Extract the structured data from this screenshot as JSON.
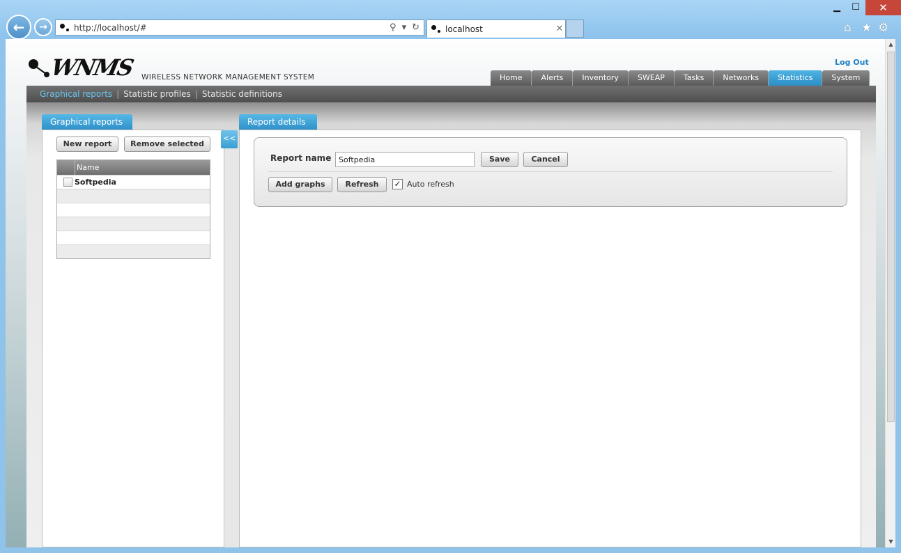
{
  "browser": {
    "url": "http://localhost/#",
    "tab_title": "localhost",
    "tab_close": "✕",
    "min_glyph": "▁",
    "max_glyph": "☐",
    "close_glyph": "✕"
  },
  "app": {
    "logo_text": "WNMS",
    "subtitle": "WIRELESS NETWORK MANAGEMENT SYSTEM",
    "logout": "Log Out"
  },
  "main_nav": {
    "items": [
      {
        "label": "Home"
      },
      {
        "label": "Alerts"
      },
      {
        "label": "Inventory"
      },
      {
        "label": "SWEAP"
      },
      {
        "label": "Tasks"
      },
      {
        "label": "Networks"
      },
      {
        "label": "Statistics",
        "active": true
      },
      {
        "label": "System"
      }
    ]
  },
  "sub_nav": {
    "items": [
      {
        "label": "Graphical reports",
        "active": true
      },
      {
        "label": "Statistic profiles"
      },
      {
        "label": "Statistic definitions"
      }
    ],
    "separator": "|"
  },
  "left_panel": {
    "tab": "Graphical reports",
    "new_report": "New report",
    "remove_selected": "Remove selected",
    "table": {
      "header_name": "Name",
      "rows": [
        {
          "name": "Softpedia"
        }
      ]
    }
  },
  "collapse_label": "<<",
  "right_panel": {
    "tab": "Report details",
    "report_name_label": "Report name",
    "report_name_value": "Softpedia",
    "save": "Save",
    "cancel": "Cancel",
    "add_graphs": "Add graphs",
    "refresh": "Refresh",
    "auto_refresh_label": "Auto refresh",
    "auto_refresh_checked": "✓"
  },
  "icons": {
    "back": "arrow-left-icon",
    "forward": "arrow-right-icon",
    "search": "search-icon",
    "reload": "refresh-icon",
    "home": "home-icon",
    "favorites": "star-icon",
    "settings": "gear-icon"
  },
  "colors": {
    "accent": "#2f91c9",
    "active_link": "#67c6ef",
    "logout": "#1b7fc4"
  }
}
